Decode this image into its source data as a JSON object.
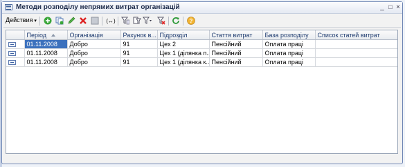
{
  "window": {
    "title": "Методи розподілу непрямих витрат організацій",
    "controls": [
      "minimize-icon",
      "maximize-icon",
      "close-icon"
    ]
  },
  "toolbar": {
    "menu_label": "Действия",
    "buttons": [
      "add-icon",
      "copy-icon",
      "edit-icon",
      "delete-icon",
      "mark-icon",
      "interval-icon",
      "filter-icon",
      "filter-list-icon",
      "clear-filter-icon",
      "refresh-icon",
      "help-icon"
    ]
  },
  "table": {
    "columns": [
      "",
      "Період",
      "Організація",
      "Рахунок в...",
      "Підрозділ",
      "Стаття витрат",
      "База розподілу",
      "Список статей витрат"
    ],
    "rows": [
      [
        "01.11.2008",
        "Добро",
        "91",
        "Цех 2",
        "Пенсійний",
        "Оплата праці",
        ""
      ],
      [
        "01.11.2008",
        "Добро",
        "91",
        "Цех 1 (ділянка п...",
        "Пенсійний",
        "Оплата праці",
        ""
      ],
      [
        "01.11.2008",
        "Добро",
        "91",
        "Цех 1 (ділянка к...",
        "Пенсійний",
        "Оплата праці",
        ""
      ]
    ]
  },
  "colors": {
    "selection": "#3c71bd",
    "header_text": "#1e3b6f",
    "window_border": "#6f86b4"
  }
}
